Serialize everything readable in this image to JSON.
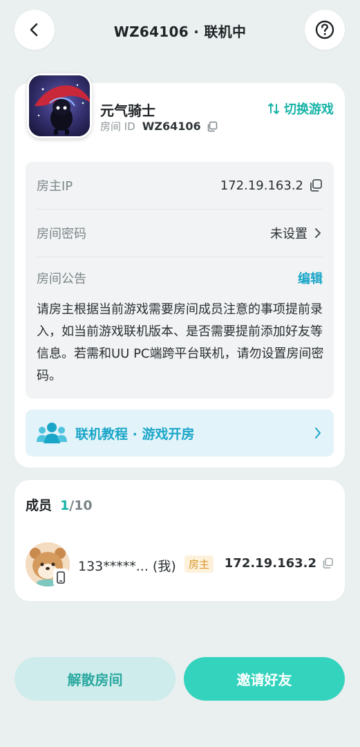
{
  "header": {
    "title": "WZ64106 · 联机中",
    "back_icon": "chevron-left-icon",
    "help_icon": "question-circle-icon"
  },
  "room": {
    "game_name": "元气骑士",
    "room_id_label": "房间 ID",
    "room_id": "WZ64106",
    "switch_game_label": "切换游戏",
    "host_ip_label": "房主IP",
    "host_ip": "172.19.163.2",
    "password_label": "房间密码",
    "password_value": "未设置",
    "announcement_label": "房间公告",
    "edit_label": "编辑",
    "announcement_text": "请房主根据当前游戏需要房间成员注意的事项提前录入，如当前游戏联机版本、是否需要提前添加好友等信息。若需和UU PC端跨平台联机，请勿设置房间密码。",
    "tutorial_label": "联机教程 · 游戏开房"
  },
  "members": {
    "title": "成员",
    "count_current": "1",
    "count_total": "/10",
    "list": [
      {
        "name": "133*****... (我)",
        "role": "房主",
        "ip": "172.19.163.2"
      }
    ]
  },
  "actions": {
    "dissolve_label": "解散房间",
    "invite_label": "邀请好友"
  },
  "colors": {
    "accent": "#17b3a8",
    "link": "#1aa6c8",
    "invite_bg": "#34d3bd",
    "dissolve_bg": "#cdeceb",
    "host_badge_bg": "#fdf1dc",
    "host_badge_text": "#d9982d"
  }
}
